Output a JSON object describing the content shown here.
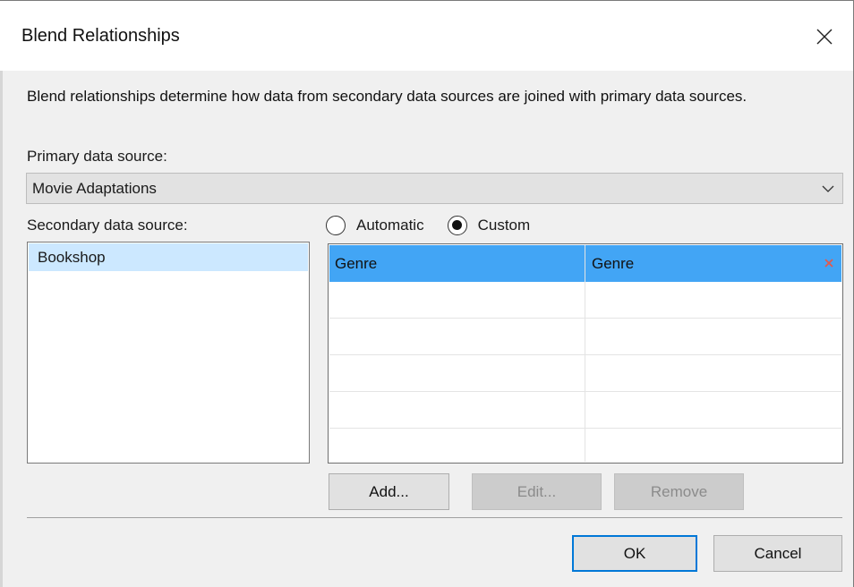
{
  "dialog": {
    "title": "Blend Relationships",
    "description": "Blend relationships determine how data from secondary data sources are joined with primary data sources.",
    "primary_label": "Primary data source:",
    "primary_value": "Movie Adaptations",
    "secondary_label": "Secondary data source:",
    "secondary_items": [
      "Bookshop"
    ],
    "mode": {
      "automatic_label": "Automatic",
      "custom_label": "Custom",
      "selected": "Custom"
    },
    "relationships": [
      {
        "primary_field": "Genre",
        "secondary_field": "Genre"
      }
    ],
    "buttons": {
      "add": "Add...",
      "edit": "Edit...",
      "remove": "Remove",
      "ok": "OK",
      "cancel": "Cancel"
    }
  },
  "colors": {
    "selected_row": "#42a5f5",
    "selected_list_item": "#cce8ff",
    "remove_icon": "#e05a4f",
    "default_button_border": "#0078d7"
  },
  "icons": {
    "close": "close-icon",
    "dropdown": "chevron-down-icon",
    "remove_row": "remove-x-icon"
  }
}
